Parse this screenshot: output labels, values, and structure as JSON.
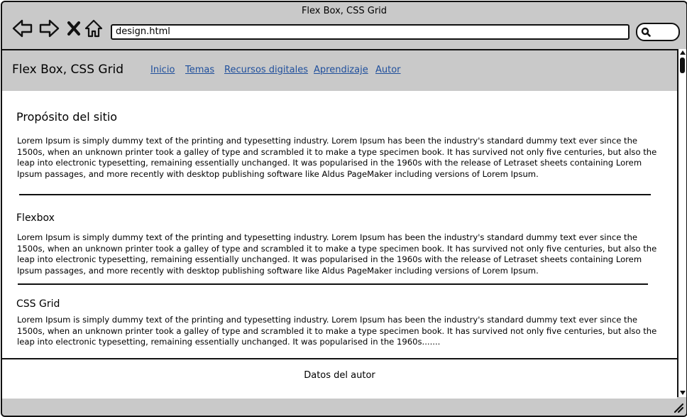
{
  "window": {
    "title": "Flex Box, CSS Grid"
  },
  "toolbar": {
    "back_icon": "arrow-left-icon",
    "forward_icon": "arrow-right-icon",
    "stop_icon": "close-icon",
    "home_icon": "home-icon",
    "url": "design.html",
    "search_icon": "search-icon"
  },
  "site": {
    "title": "Flex Box, CSS Grid",
    "nav": [
      "Inicio",
      "Temas",
      "Recursos digitales",
      "Aprendizaje",
      "Autor"
    ]
  },
  "main": {
    "section1": {
      "heading": "Propósito del sitio",
      "text": "Lorem Ipsum is simply dummy text of the printing and typesetting industry. Lorem Ipsum has been the industry's standard dummy text ever since the 1500s, when an unknown printer took a galley of type and scrambled it to make a type specimen book. It has survived not only five centuries, but also the leap into electronic typesetting, remaining essentially unchanged. It was popularised in the 1960s with the release of Letraset sheets containing Lorem Ipsum passages, and more recently with desktop publishing software like Aldus PageMaker including versions of Lorem Ipsum."
    },
    "section2": {
      "heading": "Flexbox",
      "text": "Lorem Ipsum is simply dummy text of the printing and typesetting industry. Lorem Ipsum has been the industry's standard dummy text ever since the 1500s, when an unknown printer took a galley of type and scrambled it to make a type specimen book. It has survived not only five centuries, but also the leap into electronic typesetting, remaining essentially unchanged. It was popularised in the 1960s with the release of Letraset sheets containing Lorem Ipsum passages, and more recently with desktop publishing software like Aldus PageMaker including versions of Lorem Ipsum."
    },
    "section3": {
      "heading": "CSS Grid",
      "text": "Lorem Ipsum is simply dummy text of the printing and typesetting industry. Lorem Ipsum has been the industry's standard dummy text ever since the 1500s, when an unknown printer took a galley of type and scrambled it to make a type specimen book. It has survived not only five centuries, but also the leap into electronic typesetting, remaining essentially unchanged. It was popularised in the 1960s......."
    }
  },
  "footer": {
    "text": "Datos del autor"
  },
  "colors": {
    "chrome": "#c9c9c9",
    "link": "#1f4f9c",
    "border": "#111111"
  }
}
